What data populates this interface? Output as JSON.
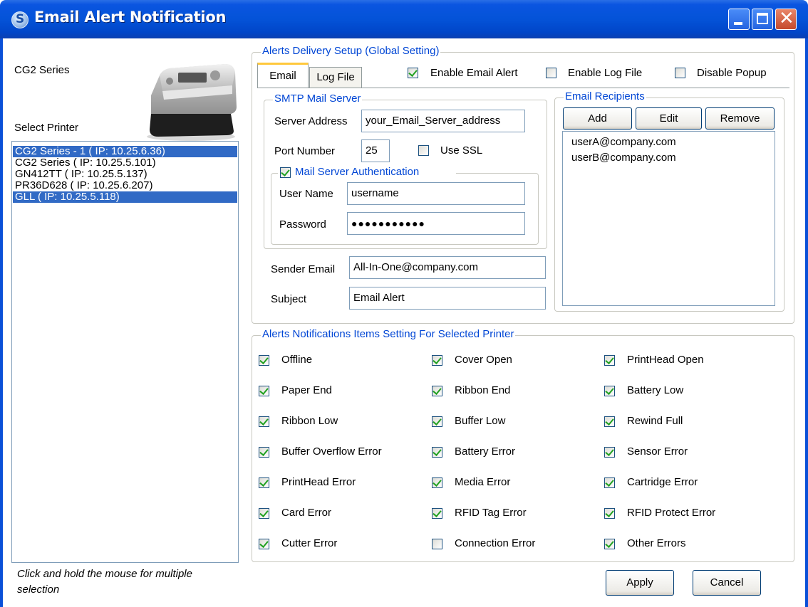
{
  "window": {
    "title": "Email Alert Notification"
  },
  "left": {
    "series_label": "CG2 Series",
    "select_label": "Select Printer",
    "printers": [
      {
        "label": "CG2 Series - 1 ( IP: 10.25.6.36)",
        "selected": true
      },
      {
        "label": "CG2 Series ( IP: 10.25.5.101)",
        "selected": false
      },
      {
        "label": "GN412TT ( IP: 10.25.5.137)",
        "selected": false
      },
      {
        "label": "PR36D628 ( IP: 10.25.6.207)",
        "selected": false
      },
      {
        "label": "GLL ( IP: 10.25.5.118)",
        "selected": true
      }
    ],
    "hint": "Click and hold the mouse for multiple selection"
  },
  "delivery": {
    "group_label": "Alerts Delivery Setup (Global Setting)",
    "tabs": [
      "Email",
      "Log File"
    ],
    "enable_email_alert": {
      "label": "Enable Email Alert",
      "checked": true
    },
    "enable_log_file": {
      "label": "Enable Log File",
      "checked": false
    },
    "disable_popup": {
      "label": "Disable Popup",
      "checked": false
    },
    "smtp": {
      "group_label": "SMTP Mail Server",
      "server_address_label": "Server Address",
      "server_address_value": "your_Email_Server_address",
      "port_label": "Port Number",
      "port_value": "25",
      "use_ssl": {
        "label": "Use SSL",
        "checked": false
      },
      "auth": {
        "label": "Mail Server Authentication",
        "checked": true
      },
      "username_label": "User Name",
      "username_value": "username",
      "password_label": "Password",
      "password_value": "●●●●●●●●●●●"
    },
    "sender_label": "Sender Email",
    "sender_value": "All-In-One@company.com",
    "subject_label": "Subject",
    "subject_value": "Email Alert",
    "recipients": {
      "group_label": "Email Recipients",
      "add": "Add",
      "edit": "Edit",
      "remove": "Remove",
      "items": [
        "userA@company.com",
        "userB@company.com"
      ]
    }
  },
  "items": {
    "group_label": "Alerts Notifications Items Setting For Selected Printer",
    "list": [
      {
        "label": "Offline",
        "checked": true
      },
      {
        "label": "Cover Open",
        "checked": true
      },
      {
        "label": "PrintHead Open",
        "checked": true
      },
      {
        "label": "Paper End",
        "checked": true
      },
      {
        "label": "Ribbon End",
        "checked": true
      },
      {
        "label": "Battery Low",
        "checked": true
      },
      {
        "label": "Ribbon Low",
        "checked": true
      },
      {
        "label": "Buffer Low",
        "checked": true
      },
      {
        "label": "Rewind Full",
        "checked": true
      },
      {
        "label": "Buffer Overflow Error",
        "checked": true
      },
      {
        "label": "Battery Error",
        "checked": true
      },
      {
        "label": "Sensor Error",
        "checked": true
      },
      {
        "label": "PrintHead Error",
        "checked": true
      },
      {
        "label": "Media Error",
        "checked": true
      },
      {
        "label": "Cartridge Error",
        "checked": true
      },
      {
        "label": "Card Error",
        "checked": true
      },
      {
        "label": "RFID Tag Error",
        "checked": true
      },
      {
        "label": "RFID Protect Error",
        "checked": true
      },
      {
        "label": "Cutter Error",
        "checked": true
      },
      {
        "label": "Connection Error",
        "checked": false
      },
      {
        "label": "Other Errors",
        "checked": true
      }
    ]
  },
  "buttons": {
    "apply": "Apply",
    "cancel": "Cancel"
  },
  "icons": [
    "app-icon",
    "printer-image",
    "minimize-icon",
    "maximize-icon",
    "close-icon"
  ]
}
